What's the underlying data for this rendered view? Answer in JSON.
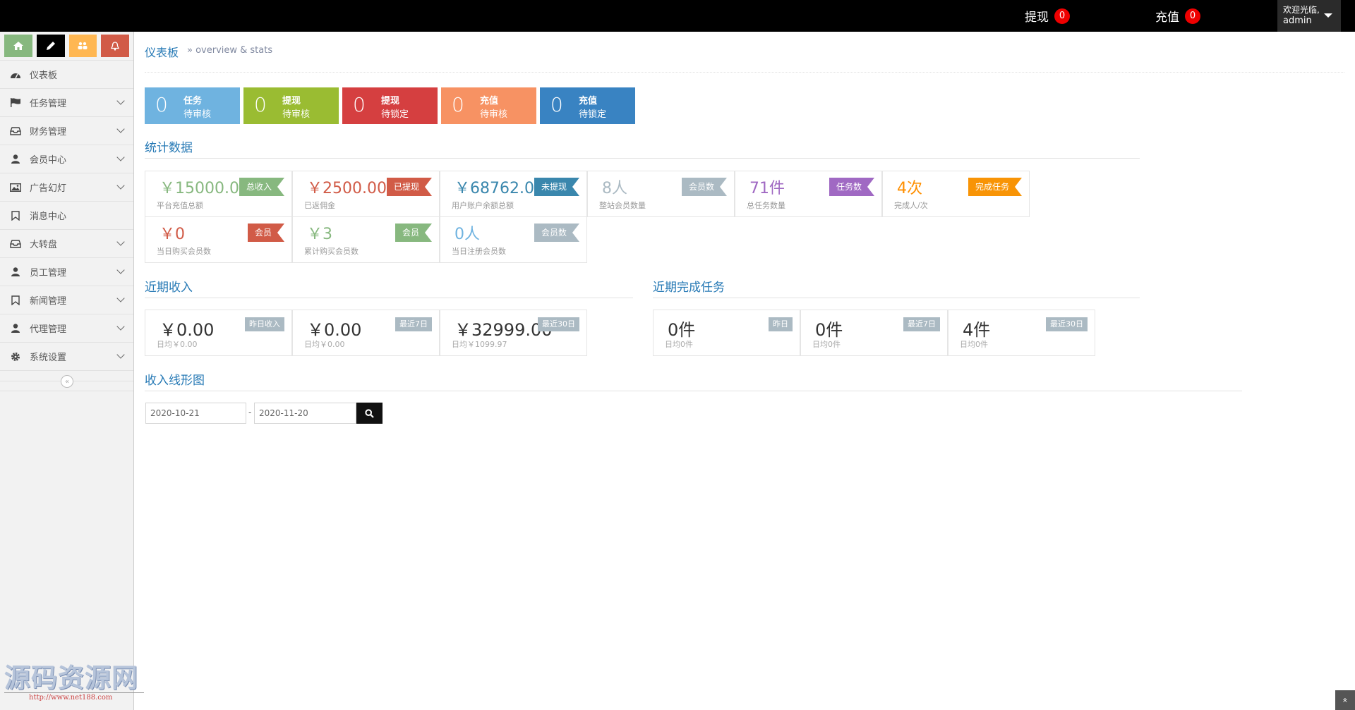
{
  "navbar": {
    "withdraw_label": "提现",
    "withdraw_count": "0",
    "recharge_label": "充值",
    "recharge_count": "0",
    "welcome": "欢迎光临,",
    "username": "admin"
  },
  "sidebar": {
    "shortcut_colors": [
      "#87b87f",
      "#000000",
      "#ffb752",
      "#d15b47"
    ],
    "items": [
      {
        "label": "仪表板",
        "icon": "dashboard-icon"
      },
      {
        "label": "任务管理",
        "icon": "flag-icon"
      },
      {
        "label": "财务管理",
        "icon": "inbox-icon"
      },
      {
        "label": "会员中心",
        "icon": "user-icon"
      },
      {
        "label": "广告幻灯",
        "icon": "image-icon"
      },
      {
        "label": "消息中心",
        "icon": "bookmark-icon"
      },
      {
        "label": "大转盘",
        "icon": "inbox-icon"
      },
      {
        "label": "员工管理",
        "icon": "user-icon"
      },
      {
        "label": "新闻管理",
        "icon": "bookmark-icon"
      },
      {
        "label": "代理管理",
        "icon": "user-icon"
      },
      {
        "label": "系统设置",
        "icon": "gear-icon"
      }
    ]
  },
  "header": {
    "title": "仪表板",
    "subtitle": "» overview & stats"
  },
  "infoboxes": [
    {
      "num": "0",
      "t1": "任务",
      "t2": "待审核",
      "color": "#6fb3e0"
    },
    {
      "num": "0",
      "t1": "提现",
      "t2": "待审核",
      "color": "#9abc32"
    },
    {
      "num": "0",
      "t1": "提现",
      "t2": "待锁定",
      "color": "#d53f40"
    },
    {
      "num": "0",
      "t1": "充值",
      "t2": "待审核",
      "color": "#f79263"
    },
    {
      "num": "0",
      "t1": "充值",
      "t2": "待锁定",
      "color": "#3983c2"
    }
  ],
  "stats": {
    "title": "统计数据",
    "items": [
      {
        "value": "￥15000.00",
        "label": "平台充值总额",
        "tag": "总收入",
        "color": "#87b87f"
      },
      {
        "value": "￥2500.00",
        "label": "已返佣金",
        "tag": "已提现",
        "color": "#d15b47"
      },
      {
        "value": "￥68762.00",
        "label": "用户账户余额总额",
        "tag": "未提现",
        "color": "#3a87ad"
      },
      {
        "value": "8人",
        "label": "整站会员数量",
        "tag": "会员数",
        "color": "#abbac3"
      },
      {
        "value": "71件",
        "label": "总任务数量",
        "tag": "任务数",
        "color": "#a069c3"
      },
      {
        "value": "4次",
        "label": "完成人/次",
        "tag": "完成任务",
        "color": "#ff8f00",
        "tag_color": "#f89406"
      },
      {
        "value": "￥0",
        "label": "当日购买会员数",
        "tag": "会员",
        "color": "#d15b47"
      },
      {
        "value": "￥3",
        "label": "累计购买会员数",
        "tag": "会员",
        "color": "#87b87f"
      },
      {
        "value": "0人",
        "label": "当日注册会员数",
        "tag": "会员数",
        "color": "#6fb3e0",
        "tag_color": "#abbac3"
      }
    ]
  },
  "income": {
    "title": "近期收入",
    "items": [
      {
        "value": "￥0.00",
        "label": "日均￥0.00",
        "tag": "昨日收入"
      },
      {
        "value": "￥0.00",
        "label": "日均￥0.00",
        "tag": "最近7日"
      },
      {
        "value": "￥32999.00",
        "label": "日均￥1099.97",
        "tag": "最近30日"
      }
    ]
  },
  "tasks": {
    "title": "近期完成任务",
    "items": [
      {
        "value": "0件",
        "label": "日均0件",
        "tag": "昨日"
      },
      {
        "value": "0件",
        "label": "日均0件",
        "tag": "最近7日"
      },
      {
        "value": "4件",
        "label": "日均0件",
        "tag": "最近30日"
      }
    ]
  },
  "chart": {
    "title": "收入线形图",
    "date_from": "2020-10-21",
    "date_sep": "-",
    "date_to": "2020-11-20"
  },
  "watermark": {
    "text": "源码资源网",
    "url": "http://www.net188.com"
  }
}
